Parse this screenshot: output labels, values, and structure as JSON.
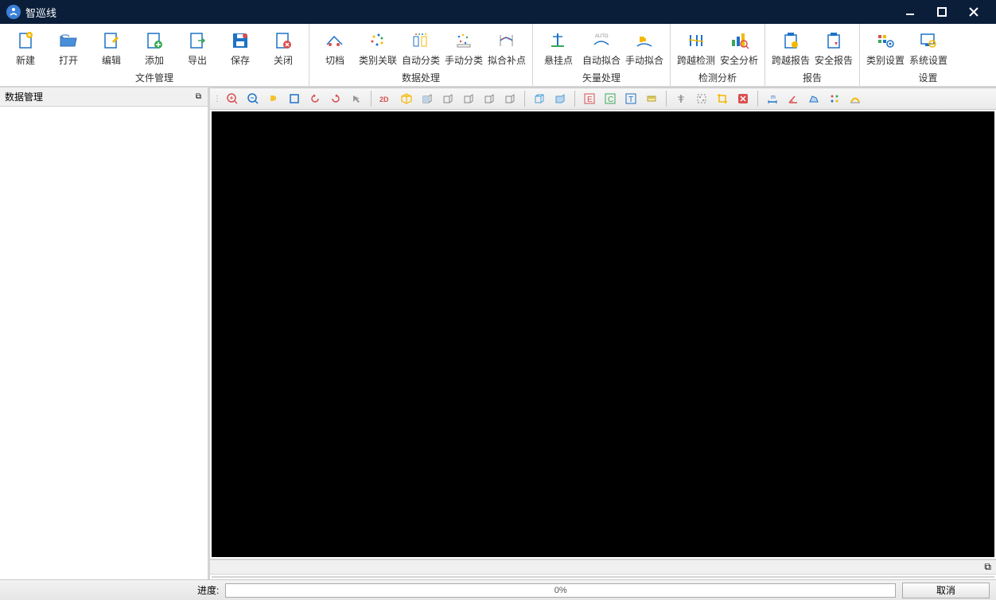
{
  "title": "智巡线",
  "ribbon": {
    "groups": [
      {
        "label": "文件管理",
        "items": [
          {
            "id": "new",
            "label": "新建"
          },
          {
            "id": "open",
            "label": "打开"
          },
          {
            "id": "edit",
            "label": "编辑"
          },
          {
            "id": "add",
            "label": "添加"
          },
          {
            "id": "export",
            "label": "导出"
          },
          {
            "id": "save",
            "label": "保存"
          },
          {
            "id": "close",
            "label": "关闭"
          }
        ]
      },
      {
        "label": "数据处理",
        "items": [
          {
            "id": "cut-span",
            "label": "切档"
          },
          {
            "id": "cat-assoc",
            "label": "类别关联"
          },
          {
            "id": "auto-class",
            "label": "自动分类"
          },
          {
            "id": "manual-class",
            "label": "手动分类"
          },
          {
            "id": "fit-fill",
            "label": "拟合补点"
          }
        ]
      },
      {
        "label": "矢量处理",
        "items": [
          {
            "id": "hang-point",
            "label": "悬挂点"
          },
          {
            "id": "auto-fit",
            "label": "自动拟合"
          },
          {
            "id": "manual-fit",
            "label": "手动拟合"
          }
        ]
      },
      {
        "label": "检测分析",
        "items": [
          {
            "id": "cross-detect",
            "label": "跨越检测"
          },
          {
            "id": "safety-analysis",
            "label": "安全分析"
          }
        ]
      },
      {
        "label": "报告",
        "items": [
          {
            "id": "cross-report",
            "label": "跨越报告"
          },
          {
            "id": "safety-report",
            "label": "安全报告"
          }
        ]
      },
      {
        "label": "设置",
        "items": [
          {
            "id": "cat-settings",
            "label": "类别设置"
          },
          {
            "id": "sys-settings",
            "label": "系统设置"
          }
        ]
      }
    ]
  },
  "panels": {
    "data_mgmt": "数据管理"
  },
  "statusbar": {
    "progress_label": "进度:",
    "progress_text": "0%",
    "cancel": "取消"
  }
}
